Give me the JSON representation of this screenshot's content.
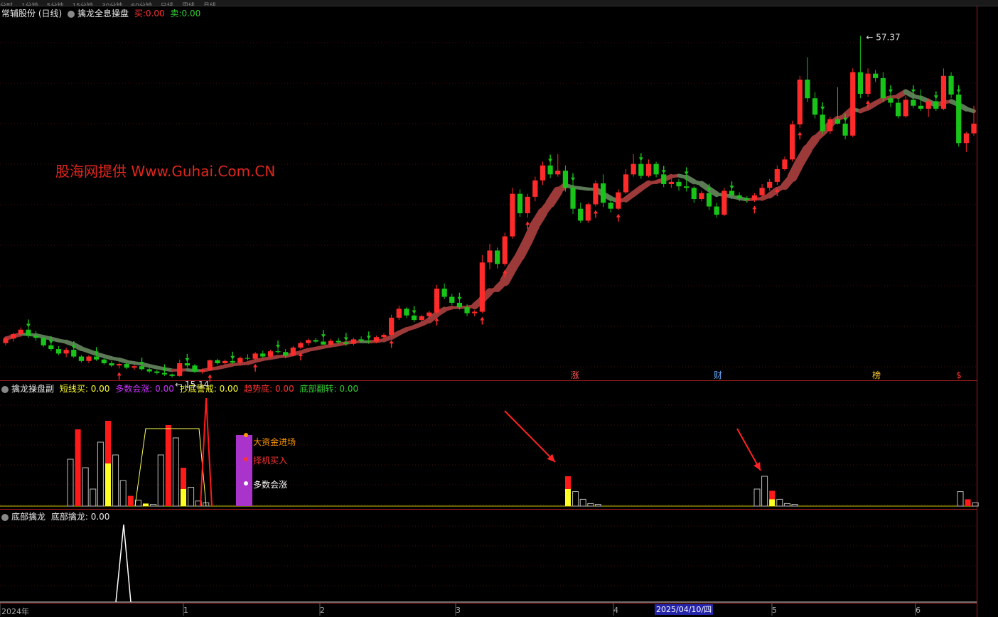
{
  "main": {
    "stock_name": "常辅股份 (日线)",
    "indicator_name": "擒龙全息操盘",
    "buy_label": "买:",
    "buy_value": "0.00",
    "sell_label": "卖:",
    "sell_value": "0.00",
    "watermark": "股海网提供 Www.Guhai.Com.CN",
    "high_label": "57.37",
    "low_label": "15.14",
    "event_marks": [
      "涨",
      "财",
      "榜",
      "$"
    ]
  },
  "sub1": {
    "name": "擒龙操盘副",
    "items": [
      {
        "label": "短线买:",
        "value": "0.00",
        "color": "#ffff33"
      },
      {
        "label": "多数会涨:",
        "value": "0.00",
        "color": "#cc33ff"
      },
      {
        "label": "抄底警戒:",
        "value": "0.00",
        "color": "#ffff33"
      },
      {
        "label": "趋势底:",
        "value": "0.00",
        "color": "#ff3333"
      },
      {
        "label": "底部翻转:",
        "value": "0.00",
        "color": "#33cc33"
      }
    ],
    "legend": [
      {
        "text": "大资金进场",
        "color": "#ff9900"
      },
      {
        "text": "择机买入",
        "color": "#ff3333"
      },
      {
        "text": "多数会涨",
        "color": "#ffffff"
      }
    ]
  },
  "sub2": {
    "name": "底部擒龙",
    "item_label": "底部擒龙:",
    "item_value": "0.00"
  },
  "axis": {
    "labels": [
      "2024年",
      "1",
      "2",
      "3",
      "4",
      "5",
      "6"
    ],
    "cursor_date": "2025/04/10/四"
  },
  "colors": {
    "up": "#ff2a2a",
    "down": "#19c419",
    "bg": "#000000",
    "grid": "#3a0a0a"
  },
  "chart_data": {
    "type": "candlestick",
    "series": [
      {
        "name": "candles",
        "ohlc": [
          [
            16.2,
            17.1,
            15.9,
            16.8
          ],
          [
            16.8,
            17.6,
            16.4,
            17.4
          ],
          [
            17.4,
            18.3,
            17.0,
            18.0
          ],
          [
            18.0,
            18.4,
            16.9,
            17.2
          ],
          [
            17.2,
            17.8,
            16.5,
            16.9
          ],
          [
            16.9,
            17.0,
            15.7,
            15.9
          ],
          [
            15.9,
            16.2,
            15.1,
            15.4
          ],
          [
            15.4,
            15.8,
            14.6,
            14.8
          ],
          [
            14.8,
            15.6,
            14.3,
            15.3
          ],
          [
            15.3,
            15.5,
            14.2,
            14.4
          ],
          [
            14.4,
            14.6,
            13.6,
            13.8
          ],
          [
            13.8,
            14.6,
            13.5,
            14.4
          ],
          [
            14.4,
            14.7,
            13.8,
            14.0
          ],
          [
            14.0,
            14.2,
            13.3,
            13.5
          ],
          [
            13.5,
            13.8,
            13.0,
            13.2
          ],
          [
            13.2,
            13.6,
            12.8,
            13.4
          ],
          [
            13.4,
            13.6,
            12.7,
            12.9
          ],
          [
            12.9,
            13.3,
            12.6,
            13.1
          ],
          [
            13.1,
            13.3,
            12.5,
            12.7
          ],
          [
            12.7,
            12.9,
            12.2,
            12.4
          ],
          [
            12.4,
            12.6,
            12.0,
            12.2
          ],
          [
            12.2,
            12.4,
            11.8,
            12.0
          ],
          [
            12.0,
            12.1,
            11.6,
            11.8
          ],
          [
            11.8,
            14.0,
            11.7,
            13.5
          ],
          [
            13.5,
            13.8,
            12.9,
            13.2
          ],
          [
            13.2,
            13.4,
            12.2,
            12.4
          ],
          [
            12.4,
            12.8,
            12.1,
            12.6
          ],
          [
            12.6,
            14.0,
            12.5,
            13.9
          ],
          [
            13.9,
            14.1,
            13.3,
            13.5
          ],
          [
            13.5,
            14.0,
            13.3,
            13.8
          ],
          [
            13.8,
            14.1,
            13.4,
            13.6
          ],
          [
            13.6,
            14.4,
            13.3,
            14.2
          ],
          [
            14.2,
            14.7,
            13.9,
            14.1
          ],
          [
            14.1,
            15.0,
            13.9,
            14.8
          ],
          [
            14.8,
            15.2,
            14.2,
            14.4
          ],
          [
            14.4,
            15.3,
            14.2,
            15.1
          ],
          [
            15.1,
            15.6,
            14.8,
            15.0
          ],
          [
            15.0,
            15.4,
            14.2,
            14.5
          ],
          [
            14.5,
            15.8,
            14.4,
            15.6
          ],
          [
            15.6,
            16.4,
            15.4,
            16.2
          ],
          [
            16.2,
            16.8,
            15.9,
            16.6
          ],
          [
            16.6,
            16.9,
            16.2,
            16.4
          ],
          [
            16.4,
            17.0,
            16.2,
            16.0
          ],
          [
            16.0,
            16.8,
            15.7,
            16.5
          ],
          [
            16.5,
            16.9,
            16.1,
            16.3
          ],
          [
            16.3,
            16.6,
            15.8,
            16.1
          ],
          [
            16.1,
            16.9,
            15.9,
            16.7
          ],
          [
            16.7,
            17.1,
            16.3,
            16.5
          ],
          [
            16.5,
            16.8,
            16.1,
            16.4
          ],
          [
            16.4,
            17.2,
            16.2,
            17.0
          ],
          [
            17.0,
            17.5,
            16.7,
            17.3
          ],
          [
            17.3,
            20.0,
            17.1,
            19.6
          ],
          [
            19.6,
            21.2,
            19.3,
            20.8
          ],
          [
            20.8,
            21.0,
            19.6,
            19.9
          ],
          [
            19.9,
            20.2,
            19.0,
            19.3
          ],
          [
            19.3,
            20.0,
            19.1,
            19.8
          ],
          [
            19.8,
            20.5,
            19.5,
            20.3
          ],
          [
            20.3,
            24.0,
            20.1,
            23.5
          ],
          [
            23.5,
            24.2,
            22.1,
            22.4
          ],
          [
            22.4,
            22.8,
            21.3,
            21.6
          ],
          [
            21.6,
            22.0,
            20.7,
            21.0
          ],
          [
            21.0,
            21.4,
            19.8,
            20.2
          ],
          [
            20.2,
            20.6,
            19.8,
            20.4
          ],
          [
            20.4,
            28.0,
            20.2,
            27.0
          ],
          [
            27.0,
            29.5,
            26.1,
            28.6
          ],
          [
            28.6,
            29.0,
            26.2,
            26.8
          ],
          [
            26.8,
            31.0,
            26.5,
            30.5
          ],
          [
            30.5,
            37.0,
            30.2,
            36.2
          ],
          [
            36.2,
            36.8,
            33.1,
            33.6
          ],
          [
            33.6,
            36.2,
            33.0,
            35.8
          ],
          [
            35.8,
            38.5,
            35.2,
            38.0
          ],
          [
            38.0,
            40.5,
            37.4,
            40.0
          ],
          [
            40.0,
            40.5,
            38.3,
            38.8
          ],
          [
            38.8,
            41.5,
            38.5,
            39.3
          ],
          [
            39.3,
            40.0,
            36.5,
            37.0
          ],
          [
            37.0,
            38.0,
            33.5,
            34.2
          ],
          [
            34.2,
            35.0,
            32.3,
            32.6
          ],
          [
            32.6,
            35.0,
            32.3,
            34.8
          ],
          [
            34.8,
            38.0,
            34.5,
            37.6
          ],
          [
            37.6,
            38.8,
            34.4,
            35.0
          ],
          [
            35.0,
            35.5,
            33.7,
            34.2
          ],
          [
            34.2,
            36.8,
            34.0,
            36.4
          ],
          [
            36.4,
            39.5,
            36.2,
            38.8
          ],
          [
            38.8,
            41.5,
            38.5,
            40.2
          ],
          [
            40.2,
            40.7,
            38.2,
            38.6
          ],
          [
            38.6,
            40.8,
            38.4,
            40.2
          ],
          [
            40.2,
            40.5,
            38.4,
            38.8
          ],
          [
            38.8,
            39.0,
            37.1,
            37.5
          ],
          [
            37.5,
            38.2,
            37.0,
            37.8
          ],
          [
            37.8,
            38.2,
            36.6,
            37.2
          ],
          [
            37.2,
            38.8,
            36.5,
            37.0
          ],
          [
            37.0,
            37.2,
            35.0,
            35.5
          ],
          [
            35.5,
            36.6,
            35.2,
            36.3
          ],
          [
            36.3,
            36.6,
            34.0,
            34.5
          ],
          [
            34.5,
            35.0,
            33.0,
            33.4
          ],
          [
            33.4,
            37.0,
            33.2,
            36.6
          ],
          [
            36.6,
            36.9,
            35.5,
            36.0
          ],
          [
            36.0,
            36.4,
            35.2,
            35.6
          ],
          [
            35.6,
            35.9,
            35.0,
            35.4
          ],
          [
            35.4,
            36.3,
            35.1,
            36.0
          ],
          [
            36.0,
            37.5,
            35.8,
            37.0
          ],
          [
            37.0,
            38.2,
            36.6,
            37.8
          ],
          [
            37.8,
            40.0,
            37.4,
            39.5
          ],
          [
            39.5,
            41.2,
            39.3,
            40.8
          ],
          [
            40.8,
            46.0,
            40.5,
            45.5
          ],
          [
            45.5,
            52.0,
            45.0,
            51.5
          ],
          [
            51.5,
            54.5,
            48.5,
            49.0
          ],
          [
            49.0,
            49.8,
            46.3,
            46.8
          ],
          [
            46.8,
            47.5,
            44.2,
            44.6
          ],
          [
            44.6,
            46.5,
            44.2,
            46.2
          ],
          [
            46.2,
            50.5,
            45.5,
            45.6
          ],
          [
            45.6,
            46.0,
            43.5,
            44.0
          ],
          [
            44.0,
            53.0,
            43.8,
            52.5
          ],
          [
            52.5,
            57.37,
            49.0,
            49.6
          ],
          [
            49.6,
            53.0,
            49.2,
            52.3
          ],
          [
            52.3,
            52.8,
            51.2,
            51.7
          ],
          [
            51.7,
            52.5,
            48.5,
            49.0
          ],
          [
            49.0,
            49.8,
            47.8,
            48.4
          ],
          [
            48.4,
            49.0,
            46.3,
            46.6
          ],
          [
            46.6,
            49.3,
            46.4,
            48.8
          ],
          [
            48.8,
            49.8,
            47.7,
            48.0
          ],
          [
            48.0,
            50.2,
            47.3,
            47.6
          ],
          [
            47.6,
            49.0,
            46.5,
            48.6
          ],
          [
            48.6,
            49.0,
            47.3,
            47.6
          ],
          [
            47.6,
            53.0,
            47.4,
            52.0
          ],
          [
            52.0,
            52.5,
            49.0,
            49.5
          ],
          [
            49.5,
            49.8,
            42.5,
            43.0
          ],
          [
            43.0,
            44.5,
            41.8,
            44.3
          ],
          [
            44.3,
            48.0,
            44.0,
            45.6
          ]
        ]
      },
      {
        "name": "ribbon",
        "values": []
      }
    ],
    "ylim": [
      11.5,
      59.5
    ],
    "sub1_bars": [
      {
        "red": 0.0,
        "white": 0.55
      },
      {
        "red": 0.9,
        "white": 0
      },
      {
        "red": 0,
        "white": 0.45
      },
      {
        "red": 0,
        "white": 0.2
      },
      {
        "red": 0,
        "white": 0.75
      },
      {
        "red": 1.0,
        "white": 0,
        "yellow": 0.5
      },
      {
        "red": 0,
        "white": 0.6
      },
      {
        "red": 0,
        "white": 0.3
      },
      {
        "red": 0.12,
        "white": 0
      },
      {
        "red": 0,
        "white": 0.07
      },
      {
        "red": 0,
        "white": 0,
        "yellow": 0.03
      },
      {
        "red": 0,
        "white": 0.02
      },
      {
        "red": 0,
        "white": 0.6
      },
      {
        "red": 0.95,
        "white": 0
      },
      {
        "red": 0,
        "white": 0.8
      },
      {
        "red": 0.45,
        "white": 0,
        "yellow": 0.2
      },
      {
        "red": 0,
        "white": 0.22
      },
      {
        "red": 0,
        "white": 0.06
      },
      {
        "red": 0,
        "white": 0.04
      }
    ]
  }
}
